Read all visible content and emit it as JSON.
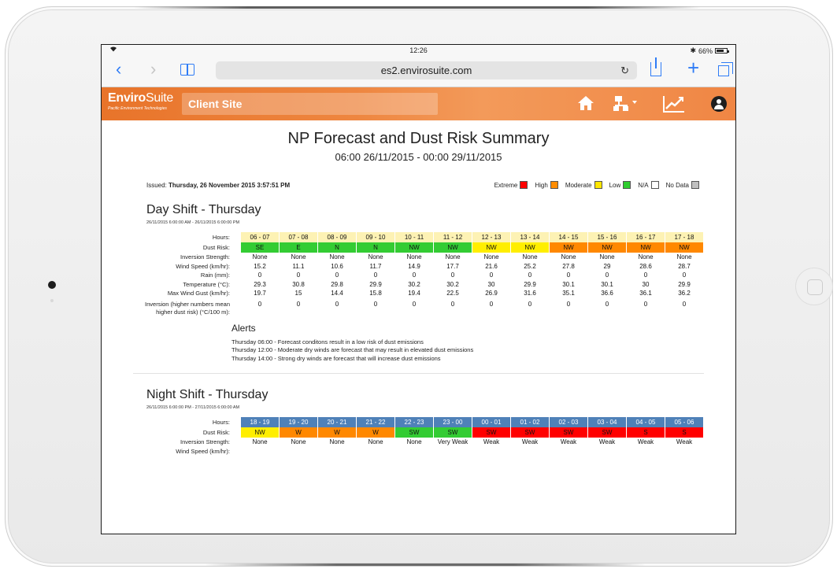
{
  "status_bar": {
    "time": "12:26",
    "battery": "66%"
  },
  "browser": {
    "url": "es2.envirosuite.com"
  },
  "app": {
    "logo_main_bold": "Enviro",
    "logo_main_thin": "Suite",
    "logo_sub": "Pacific Environment Technologies",
    "site": "Client Site"
  },
  "page": {
    "title": "NP Forecast and Dust Risk Summary",
    "range": "06:00 26/11/2015 - 00:00 29/11/2015",
    "issued_label": "Issued: ",
    "issued_value": "Thursday, 26 November 2015 3:57:51 PM"
  },
  "legend": [
    {
      "label": "Extreme",
      "color": "#ff0000"
    },
    {
      "label": "High",
      "color": "#ff8c00"
    },
    {
      "label": "Moderate",
      "color": "#ffe600"
    },
    {
      "label": "Low",
      "color": "#2ecc2e"
    },
    {
      "label": "N/A",
      "color": "#ffffff"
    },
    {
      "label": "No Data",
      "color": "#c0c0c0"
    }
  ],
  "risk_colors": {
    "low": "#33cc33",
    "moderate": "#ffee00",
    "high": "#ff8800",
    "extreme": "#ff0000"
  },
  "day_shift": {
    "title": "Day Shift - Thursday",
    "range": "26/11/2015 6:00:00 AM - 26/11/2015 6:00:00 PM",
    "labels": {
      "hours": "Hours:",
      "dust_risk": "Dust Risk:",
      "inversion_strength": "Inversion Strength:",
      "wind_speed": "Wind Speed (km/hr):",
      "rain": "Rain (mm):",
      "temperature": "Temperature (°C):",
      "max_gust": "Max Wind Gust (km/hr):",
      "inversion": "Inversion (higher numbers mean higher dust risk) (°C/100 m):"
    },
    "hours": [
      "06 - 07",
      "07 - 08",
      "08 - 09",
      "09 - 10",
      "10 - 11",
      "11 - 12",
      "12 - 13",
      "13 - 14",
      "14 - 15",
      "15 - 16",
      "16 - 17",
      "17 - 18"
    ],
    "dust_risk": [
      {
        "dir": "SE",
        "level": "low"
      },
      {
        "dir": "E",
        "level": "low"
      },
      {
        "dir": "N",
        "level": "low"
      },
      {
        "dir": "N",
        "level": "low"
      },
      {
        "dir": "NW",
        "level": "low"
      },
      {
        "dir": "NW",
        "level": "low"
      },
      {
        "dir": "NW",
        "level": "moderate"
      },
      {
        "dir": "NW",
        "level": "moderate"
      },
      {
        "dir": "NW",
        "level": "high"
      },
      {
        "dir": "NW",
        "level": "high"
      },
      {
        "dir": "NW",
        "level": "high"
      },
      {
        "dir": "NW",
        "level": "high"
      }
    ],
    "inversion_strength": [
      "None",
      "None",
      "None",
      "None",
      "None",
      "None",
      "None",
      "None",
      "None",
      "None",
      "None",
      "None"
    ],
    "wind_speed": [
      "15.2",
      "11.1",
      "10.6",
      "11.7",
      "14.9",
      "17.7",
      "21.6",
      "25.2",
      "27.8",
      "29",
      "28.6",
      "28.7"
    ],
    "rain": [
      "0",
      "0",
      "0",
      "0",
      "0",
      "0",
      "0",
      "0",
      "0",
      "0",
      "0",
      "0"
    ],
    "temperature": [
      "29.3",
      "30.8",
      "29.8",
      "29.9",
      "30.2",
      "30.2",
      "30",
      "29.9",
      "30.1",
      "30.1",
      "30",
      "29.9"
    ],
    "max_gust": [
      "19.7",
      "15",
      "14.4",
      "15.8",
      "19.4",
      "22.5",
      "26.9",
      "31.6",
      "35.1",
      "36.6",
      "36.1",
      "36.2"
    ],
    "inversion": [
      "0",
      "0",
      "0",
      "0",
      "0",
      "0",
      "0",
      "0",
      "0",
      "0",
      "0",
      "0"
    ]
  },
  "alerts": {
    "title": "Alerts",
    "items": [
      "Thursday 06:00 - Forecast conditons result in a low risk of dust emissions",
      "Thursday 12:00 - Moderate dry winds are forecast that may result in elevated dust emissions",
      "Thursday 14:00 - Strong dry winds are forecast that will increase dust emissions"
    ]
  },
  "night_shift": {
    "title": "Night Shift - Thursday",
    "range": "26/11/2015 6:00:00 PM - 27/11/2015 6:00:00 AM",
    "labels": {
      "hours": "Hours:",
      "dust_risk": "Dust Risk:",
      "inversion_strength": "Inversion Strength:",
      "wind_speed": "Wind Speed (km/hr):"
    },
    "hours": [
      "18 - 19",
      "19 - 20",
      "20 - 21",
      "21 - 22",
      "22 - 23",
      "23 - 00",
      "00 - 01",
      "01 - 02",
      "02 - 03",
      "03 - 04",
      "04 - 05",
      "05 - 06"
    ],
    "dust_risk": [
      {
        "dir": "NW",
        "level": "moderate"
      },
      {
        "dir": "W",
        "level": "high"
      },
      {
        "dir": "W",
        "level": "high"
      },
      {
        "dir": "W",
        "level": "high"
      },
      {
        "dir": "SW",
        "level": "low"
      },
      {
        "dir": "SW",
        "level": "low"
      },
      {
        "dir": "SW",
        "level": "extreme"
      },
      {
        "dir": "SW",
        "level": "extreme"
      },
      {
        "dir": "SW",
        "level": "extreme"
      },
      {
        "dir": "SW",
        "level": "extreme"
      },
      {
        "dir": "S",
        "level": "extreme"
      },
      {
        "dir": "S",
        "level": "extreme"
      }
    ],
    "inversion_strength": [
      "None",
      "None",
      "None",
      "None",
      "None",
      "Very Weak",
      "Weak",
      "Weak",
      "Weak",
      "Weak",
      "Weak",
      "Weak"
    ]
  }
}
